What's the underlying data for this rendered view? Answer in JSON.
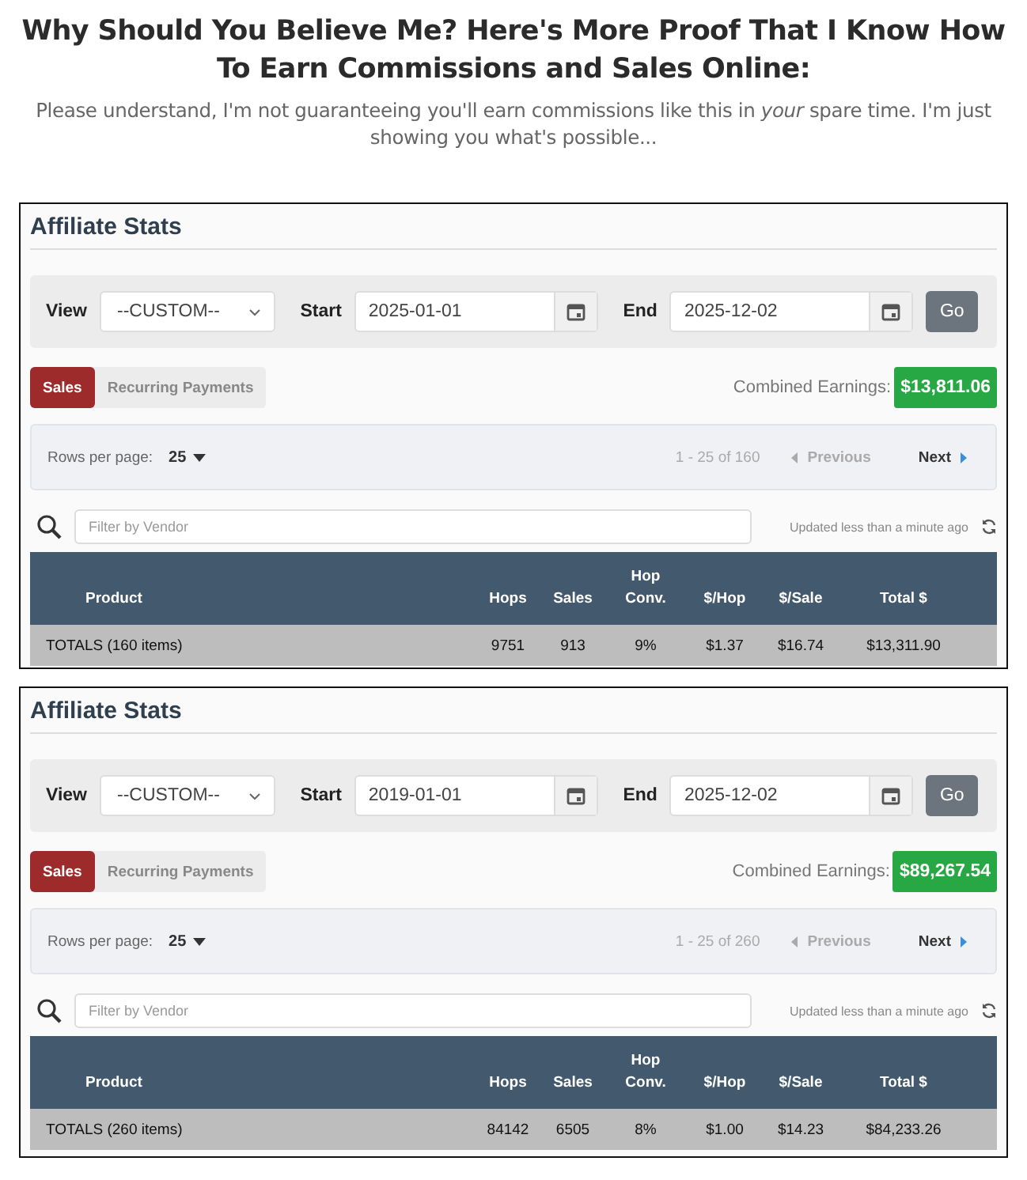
{
  "heading": "Why Should You Believe Me? Here's More Proof That I Know How To Earn Commissions and Sales Online:",
  "intro": "Please understand, I'm not guaranteeing you'll earn commissions like this in *your* spare time. I'm just showing you what's possible...",
  "panels": [
    {
      "title": "Affiliate Stats",
      "view_label": "View",
      "view": "--CUSTOM--",
      "start_label": "Start",
      "start": "2025-01-01",
      "end_label": "End",
      "end": "2025-12-02",
      "go": "Go",
      "tabs": [
        {
          "label": "Sales",
          "selected": true
        },
        {
          "label": "Recurring Payments",
          "selected": false
        }
      ],
      "earnings_label": "Combined Earnings:",
      "earnings": "$13,811.06",
      "rows_per_page_label": "Rows per page:",
      "rows_per_page": "25",
      "range": "1 - 25 of 160",
      "previous": "Previous",
      "next": "Next",
      "filter_placeholder": "Filter by Vendor",
      "updated": "Updated less than a minute ago",
      "columns": [
        "Product",
        "Hops",
        "Sales",
        "Hop Conv.",
        "$/Hop",
        "$/Sale",
        "Total $"
      ],
      "totals": [
        "TOTALS (160 items)",
        "9751",
        "913",
        "9%",
        "$1.37",
        "$16.74",
        "$13,311.90"
      ]
    },
    {
      "title": "Affiliate Stats",
      "view_label": "View",
      "view": "--CUSTOM--",
      "start_label": "Start",
      "start": "2019-01-01",
      "end_label": "End",
      "end": "2025-12-02",
      "go": "Go",
      "tabs": [
        {
          "label": "Sales",
          "selected": true
        },
        {
          "label": "Recurring Payments",
          "selected": false
        }
      ],
      "earnings_label": "Combined Earnings:",
      "earnings": "$89,267.54",
      "rows_per_page_label": "Rows per page:",
      "rows_per_page": "25",
      "range": "1 - 25 of 260",
      "previous": "Previous",
      "next": "Next",
      "filter_placeholder": "Filter by Vendor",
      "updated": "Updated less than a minute ago",
      "columns": [
        "Product",
        "Hops",
        "Sales",
        "Hop Conv.",
        "$/Hop",
        "$/Sale",
        "Total $"
      ],
      "totals": [
        "TOTALS (260 items)",
        "84142",
        "6505",
        "8%",
        "$1.00",
        "$14.23",
        "$84,233.26"
      ]
    }
  ]
}
